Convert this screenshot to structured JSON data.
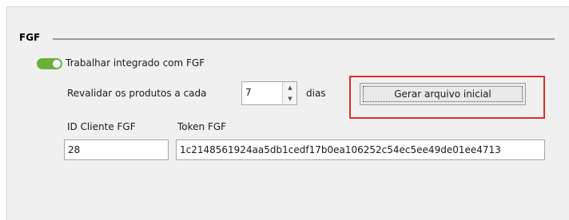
{
  "section": {
    "title": "FGF"
  },
  "integration_toggle": {
    "label": "Trabalhar integrado com FGF",
    "on": true,
    "color": "#6bb13a"
  },
  "revalidate": {
    "label_before": "Revalidar os produtos a cada",
    "value": "7",
    "label_after": "dias"
  },
  "generate_button": {
    "label": "Gerar arquivo inicial"
  },
  "client_id": {
    "label": "ID Cliente FGF",
    "value": "28"
  },
  "token": {
    "label": "Token FGF",
    "value": "1c2148561924aa5db1cedf17b0ea106252c54ec5ee49de01ee4713"
  },
  "colors": {
    "highlight": "#d9302c",
    "panel": "#f0f0f0"
  }
}
